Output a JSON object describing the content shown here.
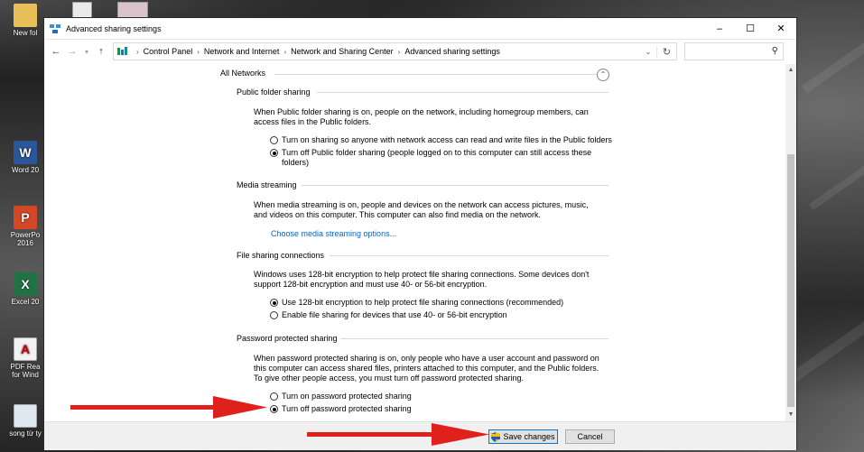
{
  "window": {
    "title": "Advanced sharing settings"
  },
  "address": {
    "crumbs": [
      "Control Panel",
      "Network and Internet",
      "Network and Sharing Center",
      "Advanced sharing settings"
    ]
  },
  "desktop_icons": [
    {
      "label": "New fol",
      "icon": "folder-icon"
    },
    {
      "label": "Word 20",
      "icon": "word-icon"
    },
    {
      "label": "PowerPo 2016",
      "icon": "powerpoint-icon"
    },
    {
      "label": "Excel 20",
      "icon": "excel-icon"
    },
    {
      "label": "PDF Rea for Wind",
      "icon": "pdf-icon"
    },
    {
      "label": "song từ ty",
      "icon": "file-icon"
    }
  ],
  "all_networks": {
    "title": "All Networks",
    "sections": {
      "public": {
        "title": "Public folder sharing",
        "desc": "When Public folder sharing is on, people on the network, including homegroup members, can access files in the Public folders.",
        "options": [
          {
            "label": "Turn on sharing so anyone with network access can read and write files in the Public folders",
            "checked": false
          },
          {
            "label": "Turn off Public folder sharing (people logged on to this computer can still access these folders)",
            "checked": true
          }
        ]
      },
      "media": {
        "title": "Media streaming",
        "desc": "When media streaming is on, people and devices on the network can access pictures, music, and videos on this computer. This computer can also find media on the network.",
        "link": "Choose media streaming options..."
      },
      "filesharing": {
        "title": "File sharing connections",
        "desc": "Windows uses 128-bit encryption to help protect file sharing connections. Some devices don't support 128-bit encryption and must use 40- or 56-bit encryption.",
        "options": [
          {
            "label": "Use 128-bit encryption to help protect file sharing connections (recommended)",
            "checked": true
          },
          {
            "label": "Enable file sharing for devices that use 40- or 56-bit encryption",
            "checked": false
          }
        ]
      },
      "password": {
        "title": "Password protected sharing",
        "desc": "When password protected sharing is on, only people who have a user account and password on this computer can access shared files, printers attached to this computer, and the Public folders. To give other people access, you must turn off password protected sharing.",
        "options": [
          {
            "label": "Turn on password protected sharing",
            "checked": false
          },
          {
            "label": "Turn off password protected sharing",
            "checked": true
          }
        ]
      }
    }
  },
  "footer": {
    "save_label": "Save changes",
    "cancel_label": "Cancel"
  },
  "colors": {
    "link": "#0066cc",
    "arrow": "#e0201b",
    "primary_border": "#0078d7"
  }
}
